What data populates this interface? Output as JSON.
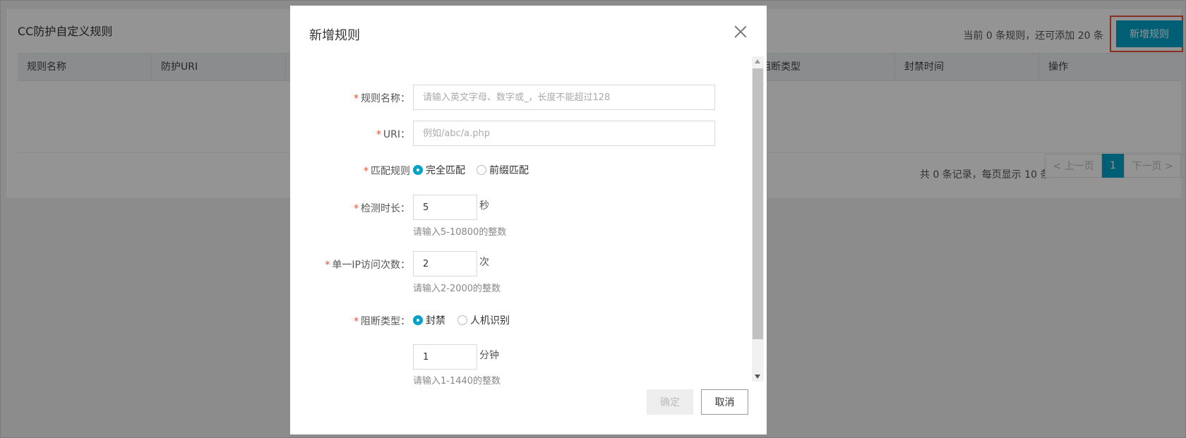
{
  "page": {
    "panel_title": "CC防护自定义规则",
    "quota_text": "当前 0 条规则，还可添加 20 条",
    "add_button": "新增规则",
    "table_headers": [
      "规则名称",
      "防护URI",
      "阻断类型",
      "封禁时间",
      "操作"
    ],
    "pagination": {
      "summary": "共 0 条记录，每页显示 10 条",
      "prev": "< 上一页",
      "current": "1",
      "next": "下一页 >"
    }
  },
  "modal": {
    "title": "新增规则",
    "required_mark": "*",
    "rule_name": {
      "label": "规则名称：",
      "placeholder": "请输入英文字母、数字或_，长度不能超过128",
      "value": ""
    },
    "uri": {
      "label": "URI：",
      "placeholder": "例如/abc/a.php",
      "value": ""
    },
    "match_rule": {
      "label": "匹配规则",
      "options": [
        "完全匹配",
        "前缀匹配"
      ],
      "selected": "完全匹配"
    },
    "detect_duration": {
      "label": "检测时长：",
      "value": "5",
      "unit": "秒",
      "hint": "请输入5-10800的整数"
    },
    "ip_visits": {
      "label": "单一IP访问次数：",
      "value": "2",
      "unit": "次",
      "hint": "请输入2-2000的整数"
    },
    "block_type": {
      "label": "阻断类型：",
      "options": [
        "封禁",
        "人机识别"
      ],
      "selected": "封禁"
    },
    "ban_time": {
      "value": "1",
      "unit": "分钟",
      "hint": "请输入1-1440的整数"
    },
    "ok_button": "确定",
    "cancel_button": "取消"
  },
  "colors": {
    "accent": "#00a2ca",
    "required": "#e8503b",
    "highlight_frame": "#e8503b"
  }
}
